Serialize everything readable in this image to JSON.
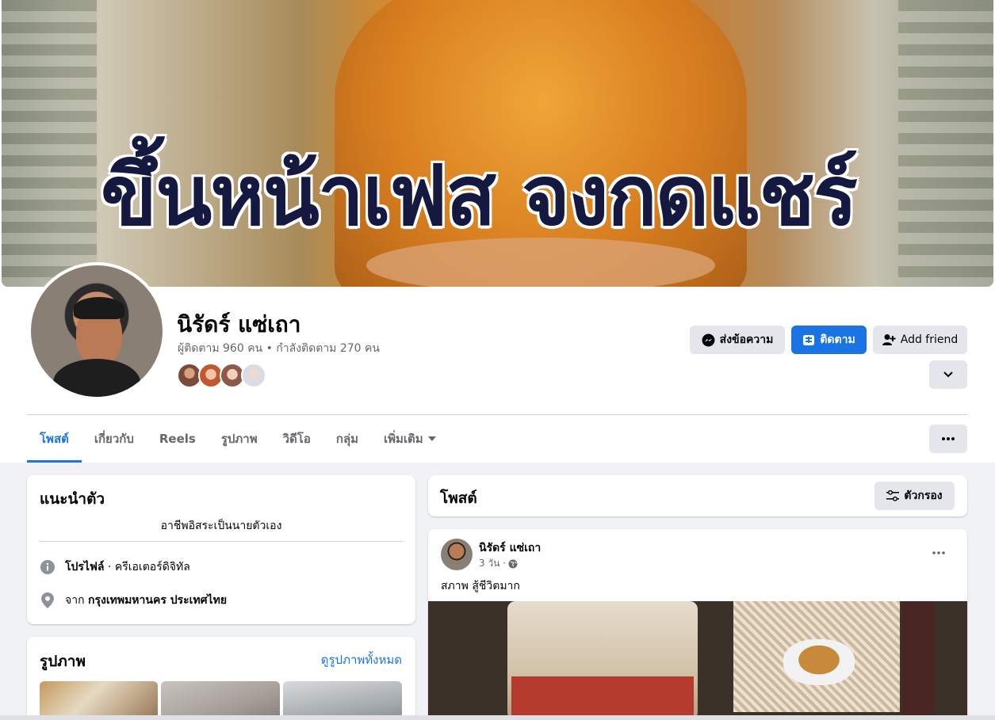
{
  "cover": {
    "text": "ขึ้นหน้าเฟส จงกดแชร์"
  },
  "profile": {
    "name": "นิรัดร์ แซ่เถา",
    "followers_text": "ผู้ติดตาม 960 คน • กำลังติดตาม 270 คน"
  },
  "actions": {
    "message_label": "ส่งข้อความ",
    "follow_label": "ติดตาม",
    "add_friend_label": "Add friend"
  },
  "tabs": [
    {
      "label": "โพสต์"
    },
    {
      "label": "เกี่ยวกับ"
    },
    {
      "label": "Reels"
    },
    {
      "label": "รูปภาพ"
    },
    {
      "label": "วิดีโอ"
    },
    {
      "label": "กลุ่ม"
    },
    {
      "label": "เพิ่มเติม"
    }
  ],
  "intro": {
    "title": "แนะนำตัว",
    "bio": "อาชีพอิสระเป็นนายตัวเอง",
    "profile_label": "โปรไฟล์",
    "profile_sep": " · ",
    "profile_value": "ครีเอเตอร์ดิจิทัล",
    "from_label": "จาก ",
    "from_value": "กรุงเทพมหานคร ประเทศไทย"
  },
  "photos": {
    "title": "รูปภาพ",
    "see_all": "ดูรูปภาพทั้งหมด"
  },
  "posts_header": {
    "title": "โพสต์",
    "filter_label": "ตัวกรอง"
  },
  "post": {
    "author": "นิรัดร์ แซ่เถา",
    "time": "3 วัน ·",
    "text": "สภาพ สู้ชีวิตมาก"
  },
  "colors": {
    "accent": "#1b74e4",
    "secondary_text": "#65676b",
    "page_bg": "#f0f2f5"
  }
}
